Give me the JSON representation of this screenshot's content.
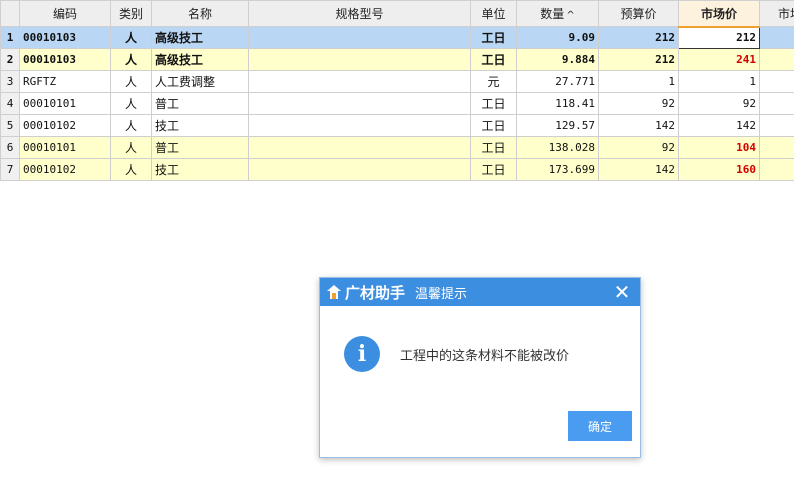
{
  "headers": [
    "",
    "编码",
    "类别",
    "名称",
    "规格型号",
    "单位",
    "数量",
    "预算价",
    "市场价",
    "市场"
  ],
  "sort_indicator": "^",
  "rows": [
    {
      "idx": "1",
      "code": "00010103",
      "type": "人",
      "name": "高级技工",
      "spec": "",
      "unit": "工日",
      "qty": "9.09",
      "budget": "212",
      "market": "212",
      "style": "sel bold",
      "market_red": false,
      "market_edit": true
    },
    {
      "idx": "2",
      "code": "00010103",
      "type": "人",
      "name": "高级技工",
      "spec": "",
      "unit": "工日",
      "qty": "9.884",
      "budget": "212",
      "market": "241",
      "style": "yel bold",
      "market_red": true,
      "market_edit": false
    },
    {
      "idx": "3",
      "code": "RGFTZ",
      "type": "人",
      "name": "人工费调整",
      "spec": "",
      "unit": "元",
      "qty": "27.771",
      "budget": "1",
      "market": "1",
      "style": "",
      "market_red": false,
      "market_edit": false
    },
    {
      "idx": "4",
      "code": "00010101",
      "type": "人",
      "name": "普工",
      "spec": "",
      "unit": "工日",
      "qty": "118.41",
      "budget": "92",
      "market": "92",
      "style": "",
      "market_red": false,
      "market_edit": false
    },
    {
      "idx": "5",
      "code": "00010102",
      "type": "人",
      "name": "技工",
      "spec": "",
      "unit": "工日",
      "qty": "129.57",
      "budget": "142",
      "market": "142",
      "style": "",
      "market_red": false,
      "market_edit": false
    },
    {
      "idx": "6",
      "code": "00010101",
      "type": "人",
      "name": "普工",
      "spec": "",
      "unit": "工日",
      "qty": "138.028",
      "budget": "92",
      "market": "104",
      "style": "yel",
      "market_red": true,
      "market_edit": false
    },
    {
      "idx": "7",
      "code": "00010102",
      "type": "人",
      "name": "技工",
      "spec": "",
      "unit": "工日",
      "qty": "173.699",
      "budget": "142",
      "market": "160",
      "style": "yel",
      "market_red": true,
      "market_edit": false
    }
  ],
  "dialog": {
    "brand": "广材助手",
    "title": "温馨提示",
    "close_glyph": "✕",
    "icon_glyph": "i",
    "message": "工程中的这条材料不能被改价",
    "ok_label": "确定"
  },
  "colors": {
    "accent": "#3c8ee0",
    "selected_row": "#b9d7f5",
    "highlight_row": "#ffffcc",
    "changed_price": "#d40000"
  }
}
